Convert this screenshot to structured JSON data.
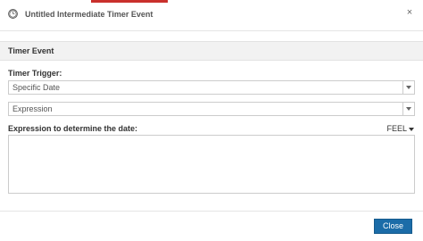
{
  "dialog": {
    "title": "Untitled Intermediate Timer Event",
    "header_icon": "timer-event-icon",
    "close_icon": "close-icon",
    "close_glyph": "×",
    "accent_color": "#c9302c"
  },
  "section": {
    "title": "Timer Event"
  },
  "form": {
    "timer_trigger_label": "Timer Trigger:",
    "timer_trigger_value": "Specific Date",
    "mode_value": "Expression",
    "expression_label": "Expression to determine the date:",
    "language_label": "FEEL",
    "expression_value": ""
  },
  "footer": {
    "close_label": "Close",
    "button_color": "#1b6ca8"
  }
}
